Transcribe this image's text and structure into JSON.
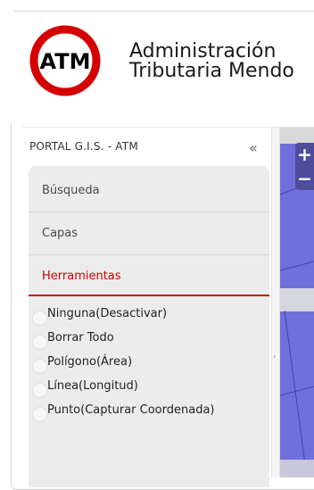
{
  "header": {
    "logo_text": "ATM",
    "brand_line1": "Administración",
    "brand_line2": "Tributaria Mendo"
  },
  "panel": {
    "title": "PORTAL G.I.S. - ATM",
    "collapse_icon": "«",
    "accordion": [
      {
        "label": "Búsqueda",
        "active": false
      },
      {
        "label": "Capas",
        "active": false
      },
      {
        "label": "Herramientas",
        "active": true
      }
    ],
    "tools": [
      {
        "label": "Ninguna(Desactivar)"
      },
      {
        "label": "Borrar Todo"
      },
      {
        "label": "Polígono(Área)"
      },
      {
        "label": "Línea(Longitud)"
      },
      {
        "label": "Punto(Capturar Coordenada)"
      }
    ]
  },
  "map": {
    "zoom_in": "+",
    "zoom_out": "−",
    "splitter_icon": "‹"
  },
  "colors": {
    "accent": "#cc0000",
    "map_fill": "#6f6fdc",
    "panel_bg": "#ececec"
  }
}
